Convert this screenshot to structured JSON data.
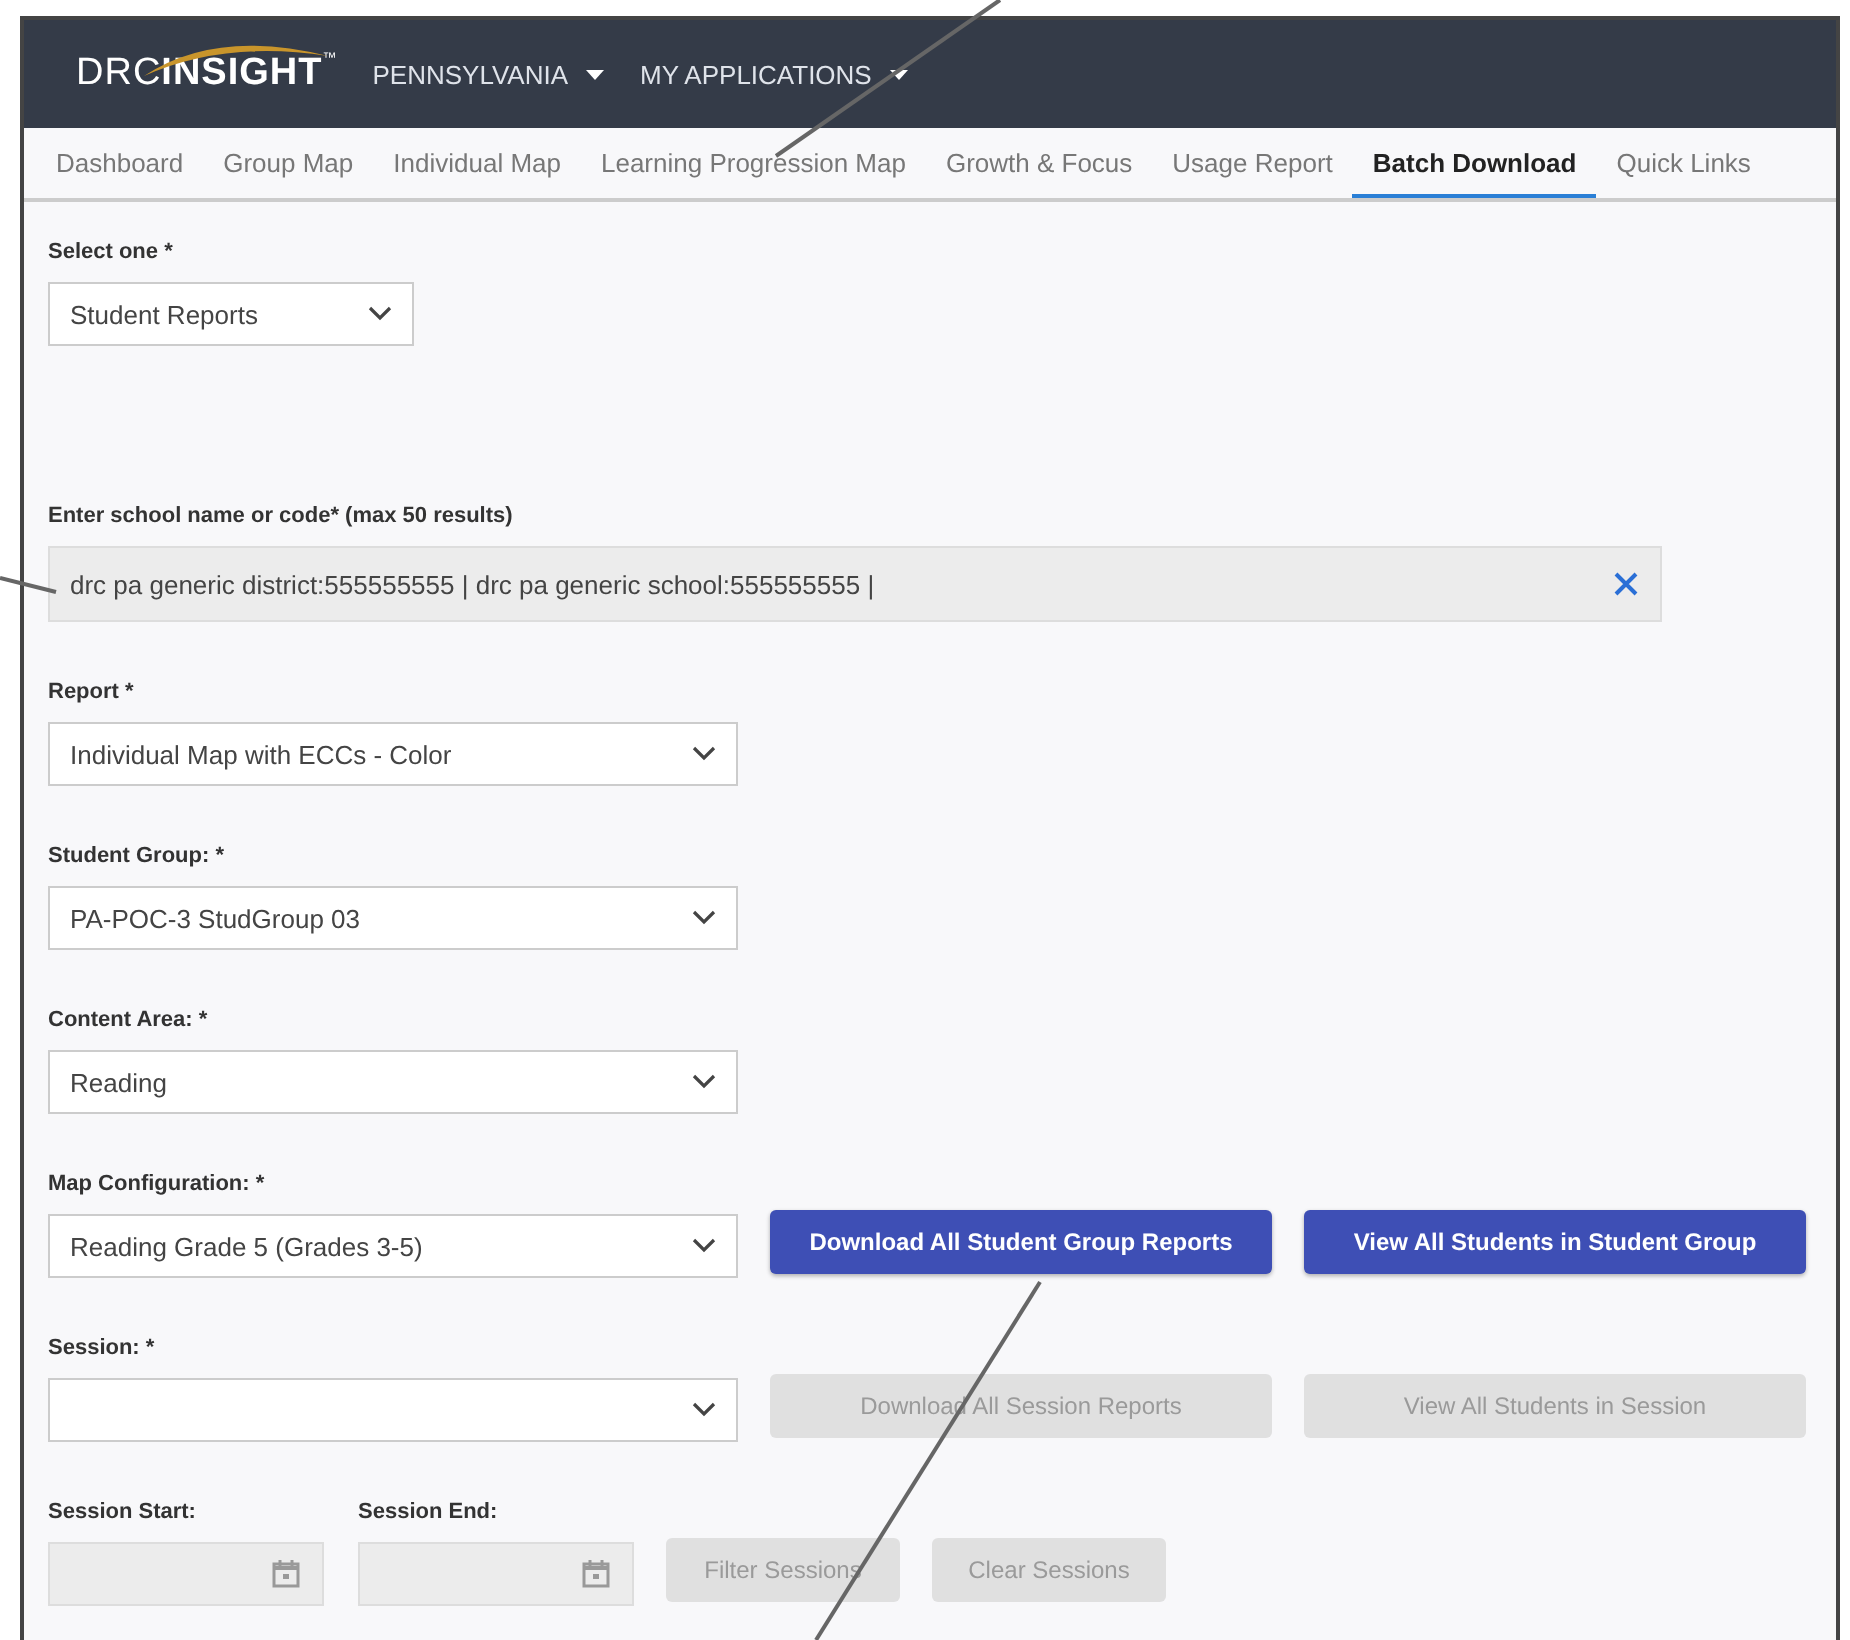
{
  "header": {
    "logo": {
      "left": "DRC",
      "right": "INSIGHT",
      "mark": "™"
    },
    "menus": [
      {
        "label": "PENNSYLVANIA"
      },
      {
        "label": "MY APPLICATIONS"
      }
    ]
  },
  "tabs": [
    {
      "label": "Dashboard",
      "selected": false
    },
    {
      "label": "Group Map",
      "selected": false
    },
    {
      "label": "Individual Map",
      "selected": false
    },
    {
      "label": "Learning Progression Map",
      "selected": false
    },
    {
      "label": "Growth & Focus",
      "selected": false
    },
    {
      "label": "Usage Report",
      "selected": false
    },
    {
      "label": "Batch Download",
      "selected": true
    },
    {
      "label": "Quick Links",
      "selected": false
    }
  ],
  "form_rows": [
    {
      "fields": [
        {
          "kind": "compact-select",
          "label": "Select one *",
          "value": "Student Reports"
        }
      ]
    },
    {
      "fields": [
        {
          "kind": "search",
          "label": "Enter school name or code* (max 50 results)",
          "value": "drc pa generic district:555555555 | drc pa generic school:555555555 |"
        }
      ]
    },
    {
      "fields": [
        {
          "kind": "select",
          "label": "Report *",
          "value": "Individual Map with ECCs - Color"
        }
      ]
    },
    {
      "fields": [
        {
          "kind": "select",
          "label": "Student Group: *",
          "value": "PA-POC-3 StudGroup 03"
        }
      ]
    },
    {
      "fields": [
        {
          "kind": "select",
          "label": "Content Area: *",
          "value": "Reading"
        }
      ]
    },
    {
      "fields": [
        {
          "kind": "select",
          "label": "Map Configuration: *",
          "value": "Reading Grade 5 (Grades 3-5)"
        }
      ],
      "buttons": [
        {
          "label": "Download All Student Group Reports",
          "disabled": false
        },
        {
          "label": "View All Students in Student Group",
          "disabled": false
        }
      ]
    },
    {
      "fields": [
        {
          "kind": "select",
          "label": "Session: *"
        }
      ],
      "buttons": [
        {
          "label": "Download All Session Reports",
          "disabled": true
        },
        {
          "label": "View All Students in Session",
          "disabled": true
        }
      ]
    },
    {
      "fields": [
        {
          "kind": "date",
          "label": "Session Start:",
          "disabled": true
        },
        {
          "kind": "date",
          "label": "Session End:",
          "disabled": true
        }
      ],
      "buttons": [
        {
          "label": "Filter Sessions",
          "disabled": true
        },
        {
          "label": "Clear Sessions",
          "disabled": true
        }
      ]
    }
  ]
}
